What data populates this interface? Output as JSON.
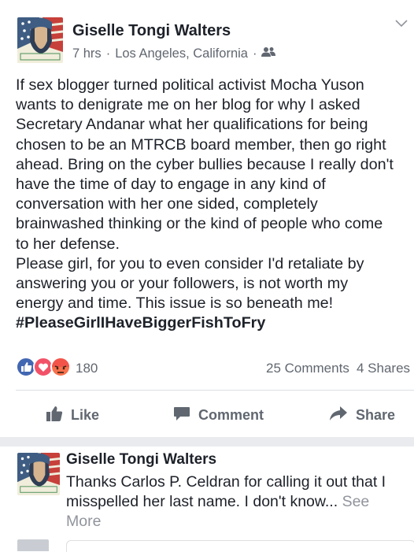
{
  "post": {
    "author": "Giselle Tongi Walters",
    "meta": {
      "time": "7 hrs",
      "location": "Los Angeles, California",
      "separator": "·",
      "audience_icon": "friends-icon"
    },
    "avatar_caption": "WE THE PEOPLE",
    "body_lines": [
      "If sex blogger turned political activist Mocha Yuson",
      "wants to denigrate me on her blog for why I asked",
      "Secretary Andanar what her qualifications for being",
      "chosen to be an MTRCB board member, then go right",
      "ahead. Bring on the cyber bullies because I really don't",
      "have the time of day to engage in any kind of",
      "conversation with her one sided, completely",
      "brainwashed thinking or the kind of people who come",
      "to her defense.",
      "Please girl, for you to even consider I'd retaliate by",
      "answering you or your followers, is not worth my",
      "energy and time. This issue is so beneath me!"
    ],
    "hashtag": "#PleaseGirlIHaveBiggerFishToFry",
    "reactions": {
      "icons": [
        "like-reaction-icon",
        "love-reaction-icon",
        "angry-reaction-icon"
      ],
      "count": "180"
    },
    "comments_count": "25 Comments",
    "shares_count": "4 Shares",
    "actions": {
      "like": "Like",
      "comment": "Comment",
      "share": "Share"
    }
  },
  "comment": {
    "author": "Giselle Tongi Walters",
    "text_lines": [
      "Thanks Carlos P. Celdran for calling it out that I",
      "misspelled her last name. I don't know..."
    ],
    "see_more_inline": "See",
    "see_more_wrap": "More"
  },
  "colors": {
    "text": "#1d2129",
    "meta": "#616770",
    "like_blue": "#4267b2",
    "love_red": "#f25268",
    "angry_orange": "#f7714c",
    "separator": "#e9ebee"
  }
}
